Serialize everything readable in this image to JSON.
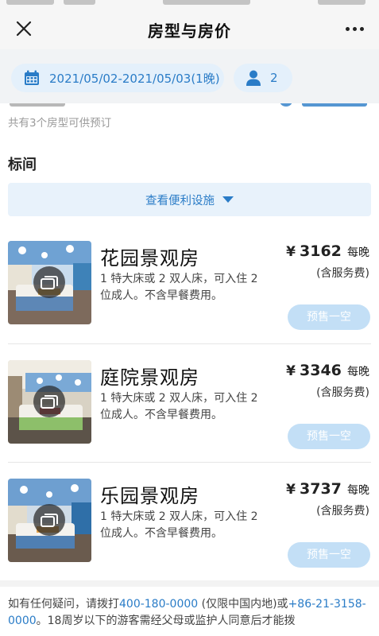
{
  "nav": {
    "title": "房型与房价"
  },
  "filters": {
    "dates": "2021/05/02-2021/05/03(1晚)",
    "guests": "2"
  },
  "availability_text": "共有3个房型可供预订",
  "section_title": "标间",
  "amenities_label": "查看便利设施",
  "rooms": [
    {
      "name": "花园景观房",
      "description": "1 特大床或 2 双人床，可入住 2 位成人。不含早餐费用。",
      "currency": "¥",
      "price": "3162",
      "unit": "每晚",
      "service_note": "(含服务费)",
      "status": "预售一空"
    },
    {
      "name": "庭院景观房",
      "description": "1 特大床或 2 双人床，可入住 2 位成人。不含早餐费用。",
      "currency": "¥",
      "price": "3346",
      "unit": "每晚",
      "service_note": "(含服务费)",
      "status": "预售一空"
    },
    {
      "name": "乐园景观房",
      "description": "1 特大床或 2 双人床，可入住 2 位成人。不含早餐费用。",
      "currency": "¥",
      "price": "3737",
      "unit": "每晚",
      "service_note": "(含服务费)",
      "status": "预售一空"
    }
  ],
  "footer": {
    "text_1": "如有任何疑问，请拨打",
    "phone_1": "400-180-0000",
    "text_2": " (仅限中国内地)或",
    "phone_2": "+86-21-3158-0000",
    "text_3": "。18周岁以下的游客需经父母或监护人同意后才能拨"
  },
  "colors": {
    "accent": "#2a7cc7",
    "pill_bg": "#e4f0fb",
    "disabled_button": "#c3dff6"
  }
}
